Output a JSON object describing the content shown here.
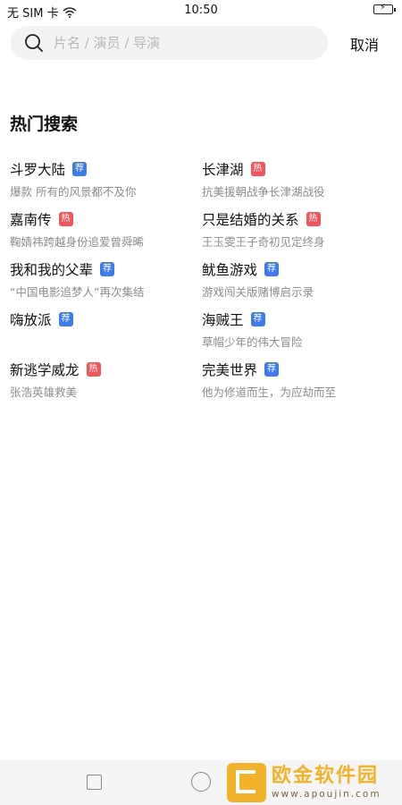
{
  "status_bar": {
    "carrier": "无 SIM 卡",
    "time": "10:50",
    "battery_icon": "battery-charging-icon",
    "wifi_icon": "wifi-icon"
  },
  "search": {
    "placeholder": "片名 / 演员 / 导演",
    "value": "",
    "cancel_label": "取消"
  },
  "section_title": "热门搜索",
  "badges": {
    "recommend": "荐",
    "hot": "热"
  },
  "colors": {
    "recommend_badge": "#3d7bea",
    "hot_badge": "#f0565a",
    "subtitle": "#8c8c8c",
    "watermark": "#f3b22b"
  },
  "hot_items": [
    {
      "title": "斗罗大陆",
      "badge": "荐",
      "subtitle": "爆款 所有的风景都不及你"
    },
    {
      "title": "长津湖",
      "badge": "热",
      "subtitle": "抗美援朝战争长津湖战役"
    },
    {
      "title": "嘉南传",
      "badge": "热",
      "subtitle": "鞠婧祎跨越身份追爱曾舜晞"
    },
    {
      "title": "只是结婚的关系",
      "badge": "热",
      "subtitle": "王玉雯王子奇初见定终身"
    },
    {
      "title": "我和我的父辈",
      "badge": "荐",
      "subtitle": "“中国电影追梦人”再次集结"
    },
    {
      "title": "鱿鱼游戏",
      "badge": "荐",
      "subtitle": "游戏闯关版赌博启示录"
    },
    {
      "title": "嗨放派",
      "badge": "荐",
      "subtitle": ""
    },
    {
      "title": "海贼王",
      "badge": "荐",
      "subtitle": "草帽少年的伟大冒险"
    },
    {
      "title": "新逃学威龙",
      "badge": "热",
      "subtitle": "张浩英雄救美"
    },
    {
      "title": "完美世界",
      "badge": "荐",
      "subtitle": "他为修道而生，为应劫而至"
    }
  ],
  "watermark": {
    "name": "欧金软件园",
    "url": "www.apoujin.com"
  }
}
